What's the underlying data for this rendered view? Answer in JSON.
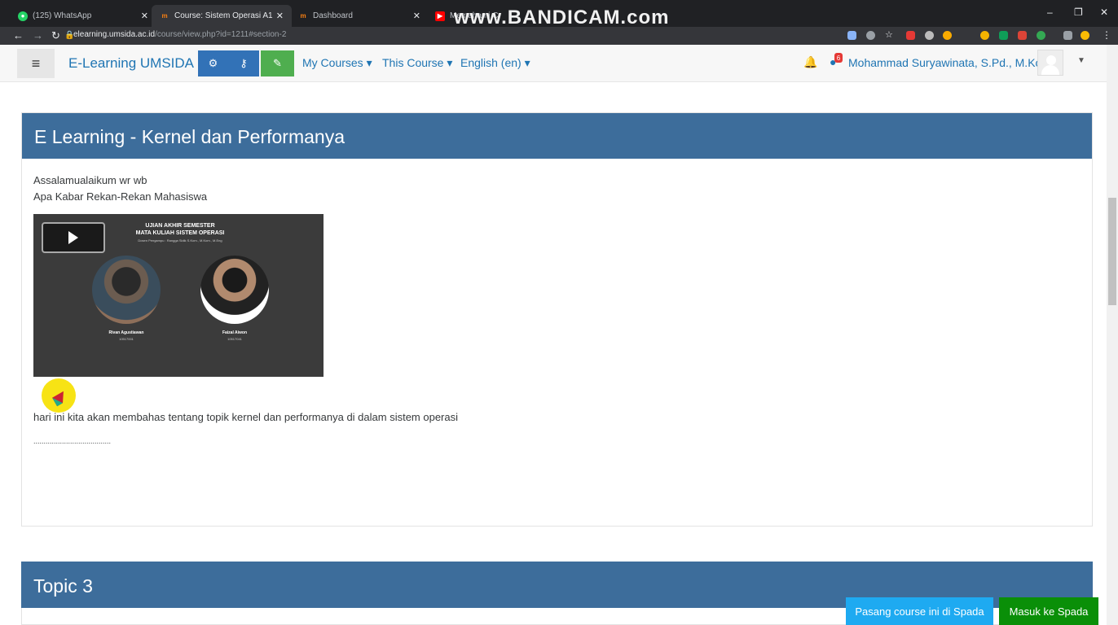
{
  "browser": {
    "tabs": [
      {
        "label": "(125) WhatsApp",
        "icon": "whatsapp-icon"
      },
      {
        "label": "Course: Sistem Operasi A1",
        "icon": "moodle-icon"
      },
      {
        "label": "Dashboard",
        "icon": "moodle-icon"
      },
      {
        "label": "Memahami Cara Ke...",
        "icon": "youtube-icon"
      }
    ],
    "watermark": "www.BANDICAM.com",
    "url_host": "elearning.umsida.ac.id",
    "url_path": "/course/view.php?id=1211#section-2"
  },
  "navbar": {
    "brand": "E-Learning UMSIDA",
    "menu": [
      "My Courses",
      "This Course",
      "English (en)"
    ],
    "message_count": "6",
    "user_name": "Mohammad Suryawinata, S.Pd., M.Kom"
  },
  "section": {
    "title": "E Learning - Kernel dan Performanya",
    "greeting": "Assalamualaikum wr wb",
    "greeting2": "Apa Kabar Rekan-Rekan Mahasiswa",
    "video": {
      "title_line1": "UJIAN AKHIR SEMESTER",
      "title_line2": "MATA KULIAH SISTEM OPERASI",
      "subtitle": "Dosen Pengampu : Rangga Sidik S.Kom., M.Kom., M.Eng",
      "person1_name": "Rivan Agustiawan",
      "person1_id": "10517001",
      "person2_name": "Faizal Aiwon",
      "person2_id": "10517041"
    },
    "description": "hari ini kita akan membahas tentang topik kernel dan performanya di dalam sistem operasi",
    "dots": "......................................"
  },
  "topic3": {
    "title": "Topic 3"
  },
  "buttons": {
    "spada": "Pasang course ini di Spada",
    "masuk": "Masuk ke Spada"
  }
}
